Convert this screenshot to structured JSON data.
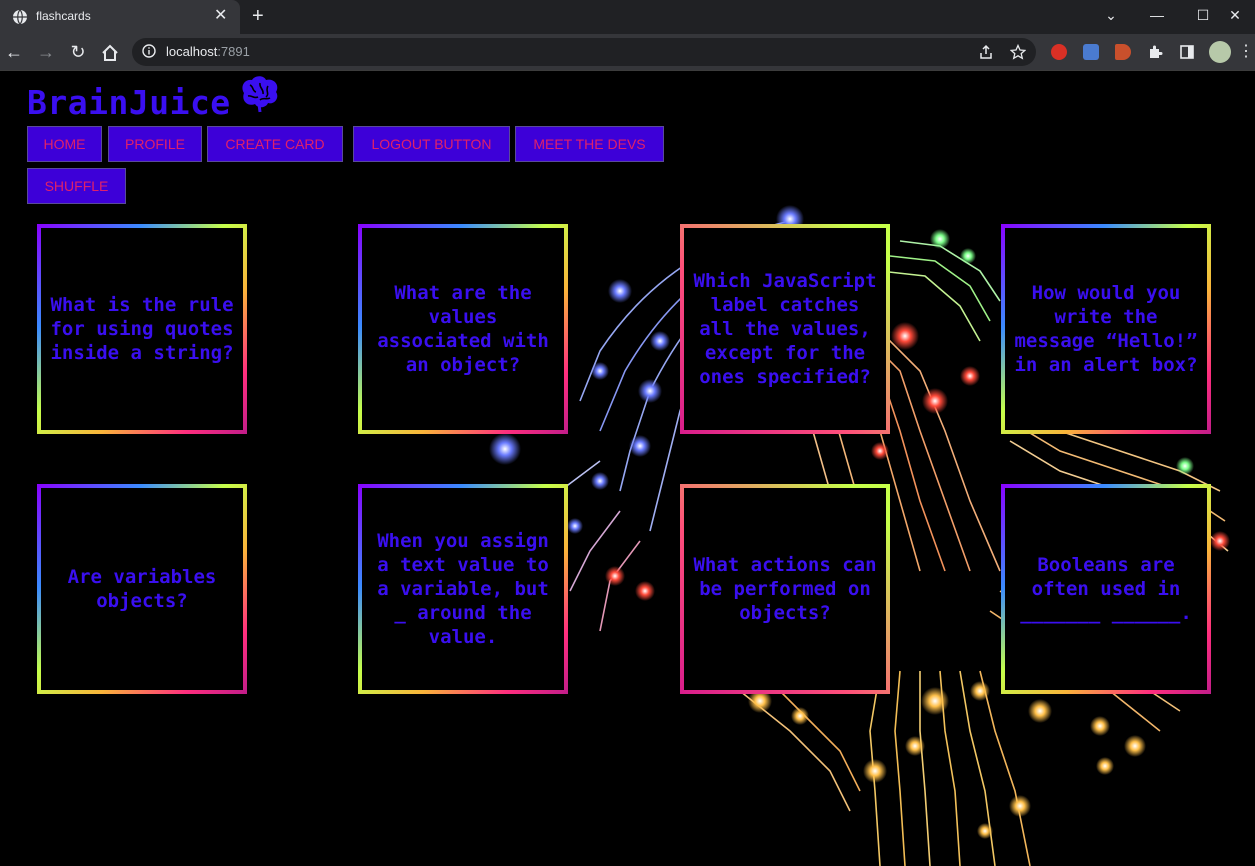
{
  "browser": {
    "tab_title": "flashcards",
    "url_host": "localhost",
    "url_port": ":7891"
  },
  "app": {
    "logo": "BrainJuice",
    "nav": [
      {
        "label": "HOME"
      },
      {
        "label": "PROFILE"
      },
      {
        "label": "CREATE CARD"
      },
      {
        "label": "LOGOUT BUTTON"
      },
      {
        "label": "MEET THE DEVS"
      },
      {
        "label": "SHUFFLE"
      }
    ],
    "cards": [
      {
        "question": "What is the rule for using quotes inside a string?"
      },
      {
        "question": "What are the values associated with an object?"
      },
      {
        "question": "Which JavaScript label catches all the values, except for the ones specified?"
      },
      {
        "question": "How would you write the message “Hello!” in an alert box?"
      },
      {
        "question": "Are variables objects?"
      },
      {
        "question": "When you assign a text value to a variable, but _ around the value."
      },
      {
        "question": "What actions can be performed on objects?"
      },
      {
        "question": "Booleans are often used in _______ ______."
      }
    ]
  },
  "colors": {
    "accent": "#3a0ff0",
    "button_bg": "#3d00d8",
    "button_text": "#e0206a",
    "page_bg": "#000000"
  },
  "icons": [
    "globe-icon",
    "close-icon",
    "new-tab-icon",
    "back-icon",
    "forward-icon",
    "reload-icon",
    "home-icon",
    "info-icon",
    "share-icon",
    "star-icon",
    "extension-icon",
    "puzzle-icon",
    "sidebar-icon",
    "avatar",
    "brain-icon"
  ]
}
